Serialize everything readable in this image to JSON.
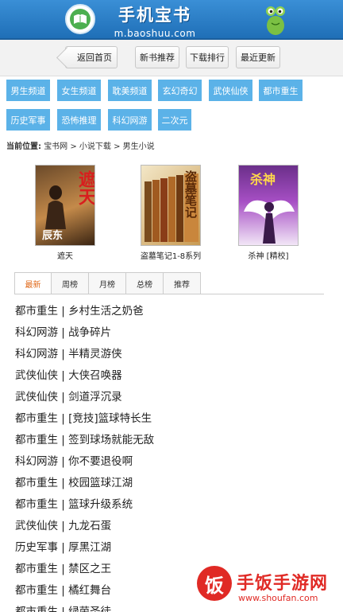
{
  "header": {
    "title": "手机宝书",
    "subtitle": "m.baoshuu.com"
  },
  "nav": {
    "back": "返回首页",
    "buttons": [
      "新书推荐",
      "下载排行",
      "最近更新"
    ]
  },
  "tags": [
    "男生频道",
    "女生频道",
    "耽美频道",
    "玄幻奇幻",
    "武侠仙侠",
    "都市重生",
    "历史军事",
    "恐怖推理",
    "科幻网游",
    "二次元"
  ],
  "location": {
    "label": "当前位置:",
    "path": "宝书网 > 小说下载 > 男生小说"
  },
  "books": [
    {
      "title": "遮天",
      "cover_text": "遮天",
      "author": "辰东"
    },
    {
      "title": "盗墓笔记1-8系列",
      "cover_text": "盗墓笔记"
    },
    {
      "title": "杀神 [精校]",
      "cover_text": "杀神"
    }
  ],
  "tabs": [
    "最新",
    "周榜",
    "月榜",
    "总榜",
    "推荐"
  ],
  "active_tab": "最新",
  "list": [
    "都市重生 | 乡村生活之奶爸",
    "科幻网游 | 战争碎片",
    "科幻网游 | 半精灵游侠",
    "武侠仙侠 | 大侠召唤器",
    "武侠仙侠 | 剑道浮沉录",
    "都市重生 | [竞技]篮球特长生",
    "都市重生 | 签到球场就能无敌",
    "科幻网游 | 你不要退役啊",
    "都市重生 | 校园篮球江湖",
    "都市重生 | 篮球升级系统",
    "武侠仙侠 | 九龙石蛋",
    "历史军事 | 厚黑江湖",
    "都市重生 | 禁区之王",
    "都市重生 | 橘红舞台",
    "都市重生 | 绿茵圣徒"
  ],
  "watermark": {
    "glyph": "饭",
    "text": "手饭手游网",
    "url": "www.shoufan.com"
  },
  "colors": {
    "header_blue": "#2a7fc8",
    "tag_blue": "#5bb2e8",
    "active_tab": "#e06a1b",
    "watermark_red": "#e02a25"
  }
}
